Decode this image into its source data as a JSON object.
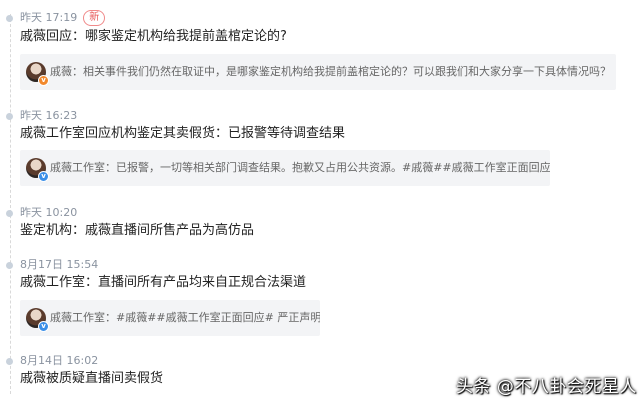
{
  "entries": [
    {
      "time": "昨天 17:19",
      "badge": "新",
      "headline": "戚薇回应：哪家鉴定机构给我提前盖棺定论的?",
      "card": {
        "text": "戚薇：相关事件我们仍然在取证中，是哪家鉴定机构给我提前盖棺定论的？可以跟我们和大家分享一下具体情况吗？",
        "verify": "orange"
      }
    },
    {
      "time": "昨天 16:23",
      "headline": "戚薇工作室回应机构鉴定其卖假货：已报警等待调查结果",
      "card": {
        "text": "戚薇工作室：已报警，一切等相关部门调查结果。抱歉又占用公共资源。#戚薇##戚薇工作室正面回应#",
        "verify": "blue"
      }
    },
    {
      "time": "昨天 10:20",
      "headline": "鉴定机构：戚薇直播间所售产品为高仿品"
    },
    {
      "time": "8月17日 15:54",
      "headline": "戚薇工作室：直播间所有产品均来自正规合法渠道",
      "card": {
        "text": "戚薇工作室：#戚薇##戚薇工作室正面回应# 严正声明‼",
        "verify": "blue"
      }
    },
    {
      "time": "8月14日 16:02",
      "headline": "戚薇被质疑直播间卖假货"
    }
  ],
  "watermark": "头条 @不八卦会死星人"
}
